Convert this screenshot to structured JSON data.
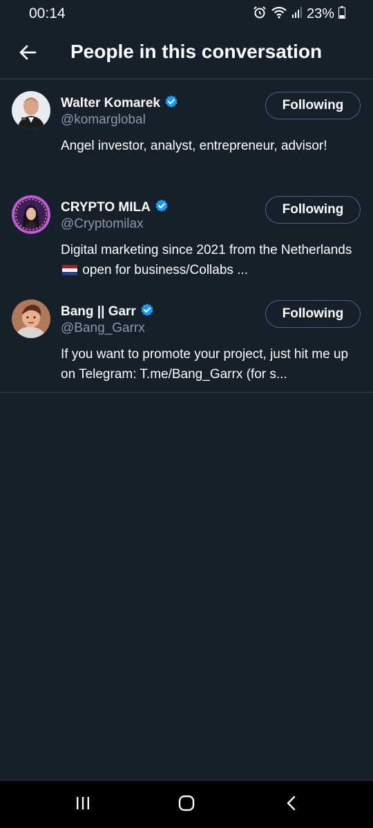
{
  "status_bar": {
    "time": "00:14",
    "battery": "23%",
    "icons": [
      "alarm-icon",
      "wifi-icon",
      "signal-icon",
      "battery-icon"
    ]
  },
  "header": {
    "title": "People in this conversation",
    "back_icon": "back-arrow-icon"
  },
  "people": [
    {
      "name": "Walter Komarek",
      "handle": "@komarglobal",
      "bio": "Angel investor, analyst, entrepreneur, advisor!",
      "verified": true,
      "follow_label": "Following"
    },
    {
      "name": "CRYPTO MILA",
      "handle": "@Cryptomilax",
      "bio_before_flag": "Digital marketing since 2021 from the Netherlands ",
      "bio_after_flag": " open for business/Collabs ...",
      "verified": true,
      "follow_label": "Following"
    },
    {
      "name": "Bang || Garr",
      "handle": "@Bang_Garrx",
      "bio": "If you want to promote your project, just hit me up on Telegram: T.me/Bang_Garrx (for s...",
      "verified": true,
      "follow_label": "Following"
    }
  ],
  "nav_bar": {
    "icons": [
      "recent-apps-icon",
      "home-icon",
      "back-icon"
    ]
  },
  "colors": {
    "background": "#15202b",
    "verified_badge": "#1d9bf0",
    "secondary_text": "#8b98a5",
    "divider": "#38444d"
  }
}
